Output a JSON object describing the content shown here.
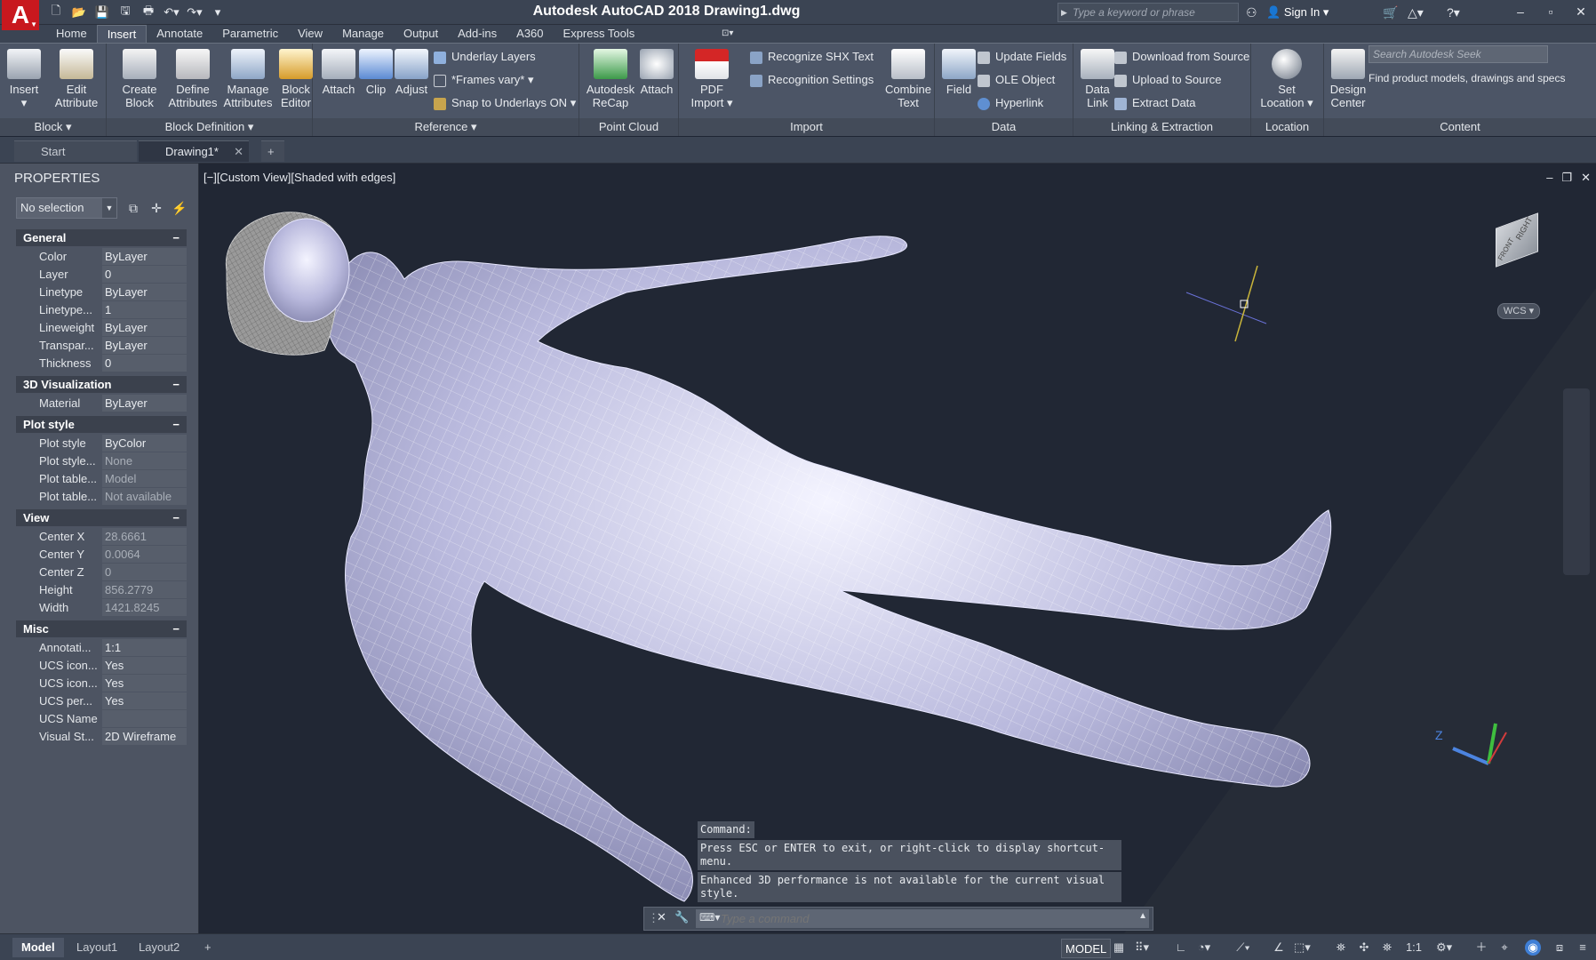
{
  "app": {
    "logo": "A",
    "title": "Autodesk AutoCAD 2018    Drawing1.dwg"
  },
  "quick_access": [
    "new-icon",
    "open-icon",
    "save-icon",
    "saveas-icon",
    "print-icon",
    "undo-icon",
    "redo-icon"
  ],
  "titlebar": {
    "search_placeholder": "Type a keyword or phrase",
    "sign_in": "Sign In"
  },
  "ribbon_tabs": [
    "Home",
    "Insert",
    "Annotate",
    "Parametric",
    "View",
    "Manage",
    "Output",
    "Add-ins",
    "A360",
    "Express Tools"
  ],
  "active_tab": "Insert",
  "ribbon": {
    "block": {
      "title": "Block",
      "insert": "Insert",
      "edit": "Edit",
      "edit2": "Attribute"
    },
    "blockdef": {
      "title": "Block Definition",
      "create": "Create",
      "create2": "Block",
      "define": "Define",
      "define2": "Attributes",
      "manage": "Manage",
      "manage2": "Attributes",
      "editor": "Block",
      "editor2": "Editor"
    },
    "reference": {
      "title": "Reference",
      "attach": "Attach",
      "clip": "Clip",
      "adjust": "Adjust",
      "underlay": "Underlay Layers",
      "frames": "*Frames vary*",
      "snap": "Snap to Underlays ON"
    },
    "pointcloud": {
      "title": "Point Cloud",
      "recap": "Autodesk",
      "recap2": "ReCap",
      "attach": "Attach"
    },
    "import": {
      "title": "Import",
      "pdf": "PDF",
      "pdf2": "Import",
      "shx": "Recognize SHX Text",
      "settings": "Recognition Settings",
      "combine": "Combine",
      "combine2": "Text"
    },
    "data": {
      "title": "Data",
      "field": "Field",
      "update": "Update Fields",
      "ole": "OLE Object",
      "hyperlink": "Hyperlink"
    },
    "linking": {
      "title": "Linking & Extraction",
      "datalink": "Data",
      "datalink2": "Link",
      "download": "Download from Source",
      "upload": "Upload to Source",
      "extract": "Extract  Data"
    },
    "location": {
      "title": "Location",
      "set": "Set",
      "set2": "Location"
    },
    "content": {
      "title": "Content",
      "design": "Design",
      "design2": "Center",
      "seek_placeholder": "Search Autodesk Seek",
      "seek_desc": "Find product models, drawings and specs"
    }
  },
  "doc_tabs": {
    "start": "Start",
    "drawing": "Drawing1*"
  },
  "properties": {
    "title": "PROPERTIES",
    "selection": "No selection",
    "sections": [
      {
        "name": "General",
        "rows": [
          {
            "label": "Color",
            "value": "ByLayer"
          },
          {
            "label": "Layer",
            "value": "0"
          },
          {
            "label": "Linetype",
            "value": "ByLayer"
          },
          {
            "label": "Linetype...",
            "value": "1"
          },
          {
            "label": "Lineweight",
            "value": "ByLayer"
          },
          {
            "label": "Transpar...",
            "value": "ByLayer"
          },
          {
            "label": "Thickness",
            "value": "0"
          }
        ]
      },
      {
        "name": "3D Visualization",
        "rows": [
          {
            "label": "Material",
            "value": "ByLayer"
          }
        ]
      },
      {
        "name": "Plot style",
        "rows": [
          {
            "label": "Plot style",
            "value": "ByColor"
          },
          {
            "label": "Plot style...",
            "value": "None"
          },
          {
            "label": "Plot table...",
            "value": "Model"
          },
          {
            "label": "Plot table...",
            "value": "Not available"
          }
        ]
      },
      {
        "name": "View",
        "rows": [
          {
            "label": "Center X",
            "value": "28.6661"
          },
          {
            "label": "Center Y",
            "value": "0.0064"
          },
          {
            "label": "Center Z",
            "value": "0"
          },
          {
            "label": "Height",
            "value": "856.2779"
          },
          {
            "label": "Width",
            "value": "1421.8245"
          }
        ]
      },
      {
        "name": "Misc",
        "rows": [
          {
            "label": "Annotati...",
            "value": "1:1"
          },
          {
            "label": "UCS icon...",
            "value": "Yes"
          },
          {
            "label": "UCS icon...",
            "value": "Yes"
          },
          {
            "label": "UCS per...",
            "value": "Yes"
          },
          {
            "label": "UCS Name",
            "value": ""
          },
          {
            "label": "Visual St...",
            "value": "2D Wireframe"
          }
        ]
      }
    ]
  },
  "viewport": {
    "label": "[−][Custom View][Shaded with edges]",
    "viewcube_face": "RIGHT",
    "viewcube_face2": "FRONT",
    "wcs": "WCS"
  },
  "command": {
    "label": "Command:",
    "history": [
      "Press ESC or ENTER to exit, or right-click to display shortcut-menu.",
      "Enhanced 3D performance is not available for the current visual style."
    ],
    "placeholder": "Type a command"
  },
  "status": {
    "layouts": [
      "Model",
      "Layout1",
      "Layout2"
    ],
    "model": "MODEL",
    "scale": "1:1"
  }
}
